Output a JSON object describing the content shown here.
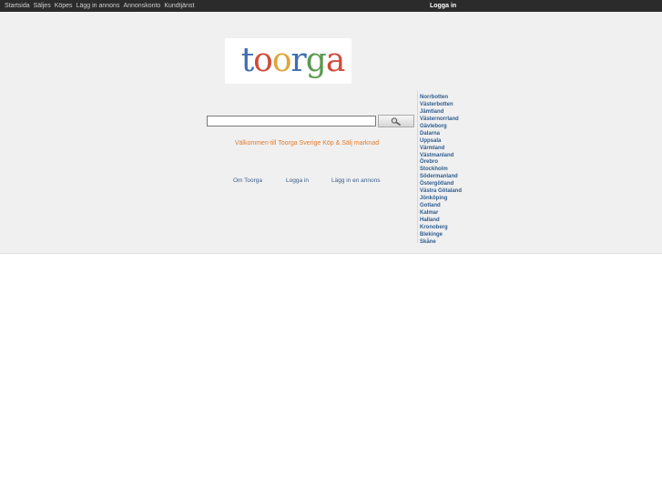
{
  "topnav": {
    "items": [
      "Startsida",
      "Säljes",
      "Köpes",
      "Lägg in annons",
      "Annonskonto",
      "Kundtjänst"
    ],
    "login": "Logga in"
  },
  "logo": {
    "letters": [
      {
        "char": "t",
        "color": "#3f6fb0"
      },
      {
        "char": "o",
        "color": "#d04b3a"
      },
      {
        "char": "o",
        "color": "#e0a43a"
      },
      {
        "char": "r",
        "color": "#3f6fb0"
      },
      {
        "char": "g",
        "color": "#5a9a4e"
      },
      {
        "char": "a",
        "color": "#d04b3a"
      }
    ]
  },
  "search": {
    "value": ""
  },
  "welcome": "Välkommen till Toorga Sverige Köp & Sälj marknad",
  "footer": {
    "about": "Om Toorga",
    "login": "Logga in",
    "post_ad": "Lägg in en annons"
  },
  "regions": [
    "Norrbotten",
    "Västerbotten",
    "Jämtland",
    "Västernorrland",
    "Gävleborg",
    "Dalarna",
    "Uppsala",
    "Värmland",
    "Västmanland",
    "Örebro",
    "Stockholm",
    "Södermanland",
    "Östergötland",
    "Västra Götaland",
    "Jönköping",
    "Gotland",
    "Kalmar",
    "Halland",
    "Kronoberg",
    "Blekinge",
    "Skåne"
  ]
}
